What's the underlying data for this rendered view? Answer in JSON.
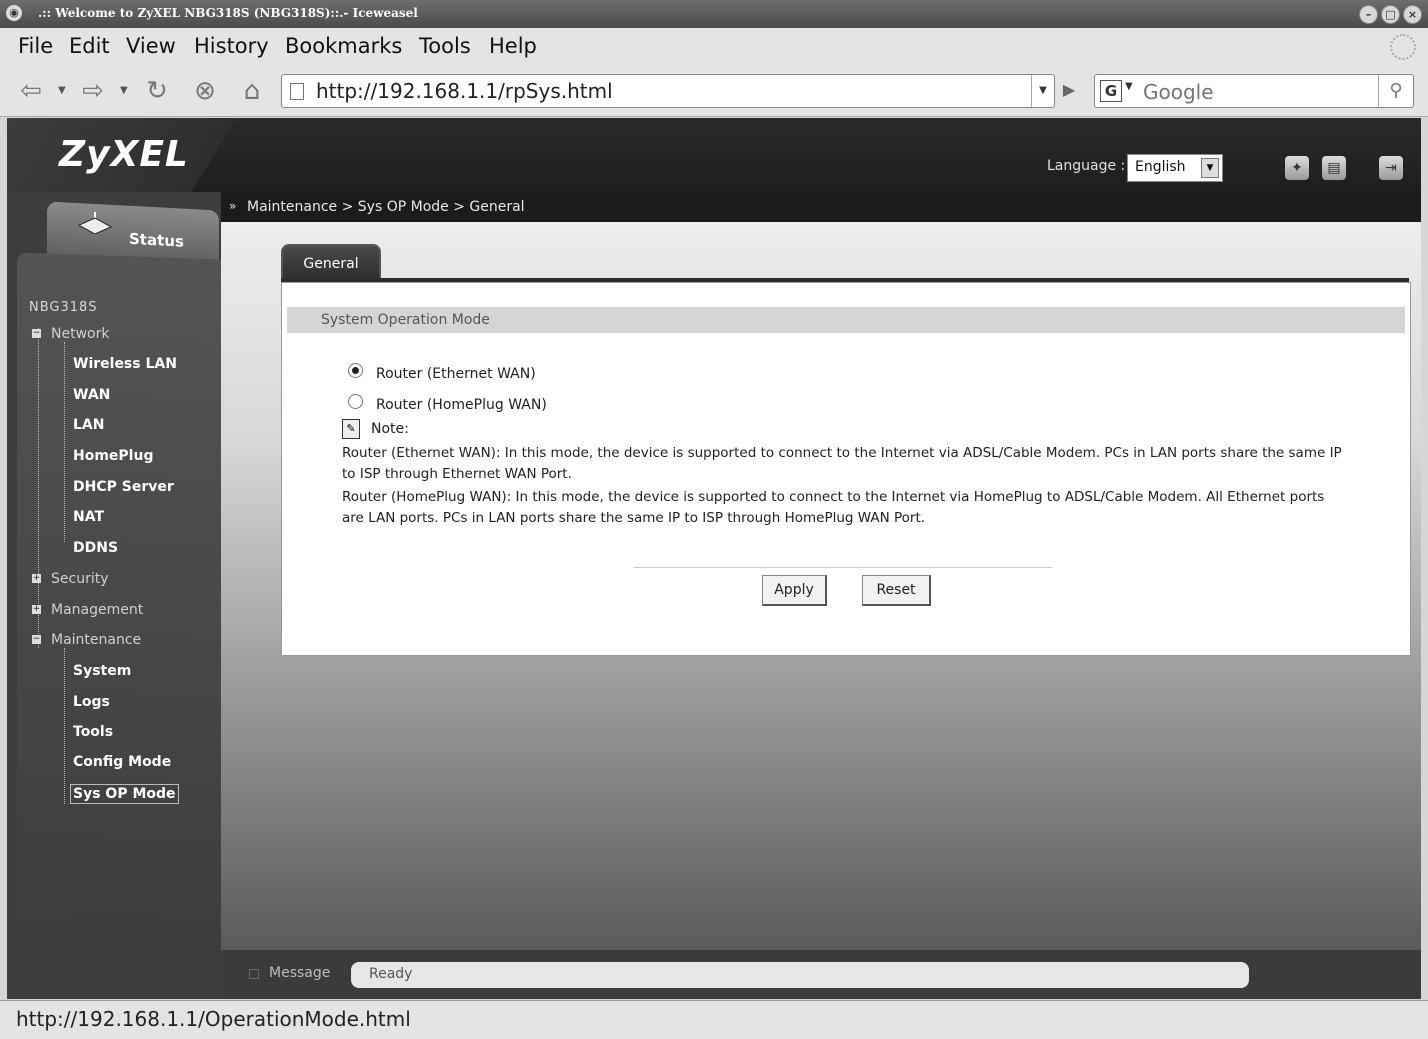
{
  "window": {
    "title": ".:: Welcome to ZyXEL NBG318S (NBG318S)::.- Iceweasel"
  },
  "menu": [
    "File",
    "Edit",
    "View",
    "History",
    "Bookmarks",
    "Tools",
    "Help"
  ],
  "toolbar": {
    "url": "http://192.168.1.1/rpSys.html",
    "search_placeholder": "Google",
    "icons": [
      "back-icon",
      "forward-icon",
      "reload-icon",
      "stop-icon",
      "home-icon",
      "go-icon",
      "search-icon"
    ]
  },
  "header": {
    "logo": "ZyXEL",
    "language_label": "Language :",
    "language_value": "English"
  },
  "breadcrumb": "Maintenance > Sys OP Mode > General",
  "sidebar": {
    "status_tab": "Status",
    "device": "NBG318S",
    "groups": [
      {
        "label": "Network",
        "expanded": true,
        "items": [
          "Wireless LAN",
          "WAN",
          "LAN",
          "HomePlug",
          "DHCP Server",
          "NAT",
          "DDNS"
        ]
      },
      {
        "label": "Security",
        "expanded": false
      },
      {
        "label": "Management",
        "expanded": false
      },
      {
        "label": "Maintenance",
        "expanded": true,
        "items": [
          "System",
          "Logs",
          "Tools",
          "Config Mode",
          "Sys OP Mode"
        ]
      }
    ],
    "selected": "Sys OP Mode"
  },
  "main": {
    "tab": "General",
    "section_title": "System Operation Mode",
    "options": [
      {
        "label": "Router (Ethernet WAN)",
        "checked": true
      },
      {
        "label": "Router (HomePlug WAN)",
        "checked": false
      }
    ],
    "note_label": "Note:",
    "note_1": "Router (Ethernet WAN): In this mode, the device is supported to connect to the Internet via ADSL/Cable Modem. PCs in LAN ports share the same IP to ISP through Ethernet WAN Port.",
    "note_2": "Router (HomePlug WAN): In this mode, the device is supported to connect to the Internet via HomePlug to ADSL/Cable Modem. All Ethernet ports are LAN ports. PCs in LAN ports share the same IP to ISP through HomePlug WAN Port.",
    "apply": "Apply",
    "reset": "Reset"
  },
  "message_bar": {
    "label": "Message",
    "value": "Ready"
  },
  "status_bar": "http://192.168.1.1/OperationMode.html"
}
